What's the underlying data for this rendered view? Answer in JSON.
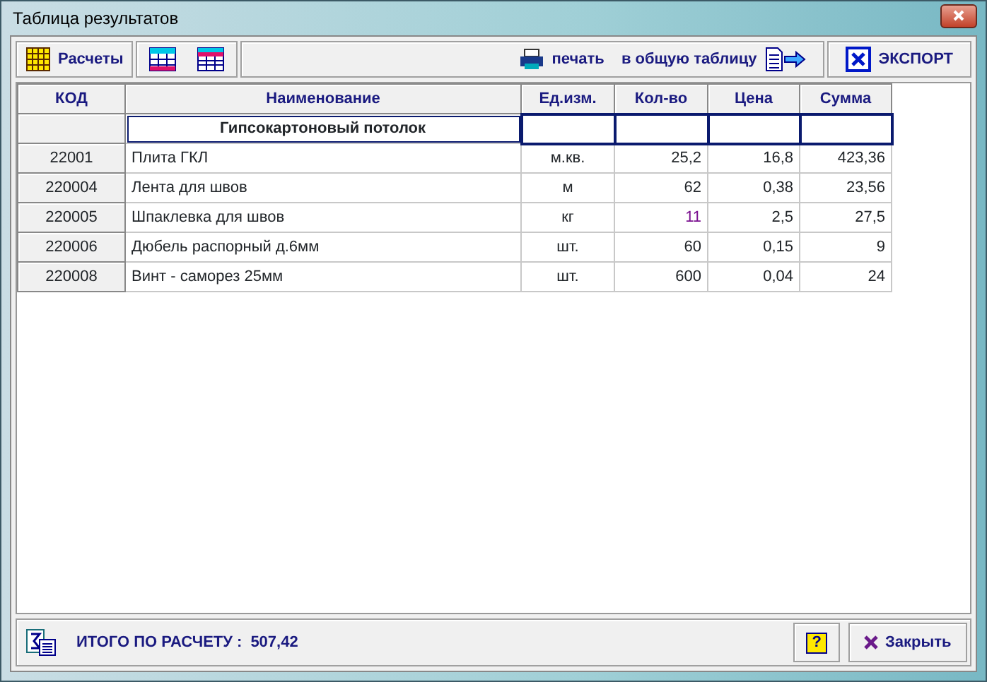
{
  "window": {
    "title": "Таблица результатов"
  },
  "toolbar": {
    "calc_button": "Расчеты",
    "print_button": "печать",
    "to_table_button": "в общую таблицу",
    "export_button": "ЭКСПОРТ"
  },
  "table": {
    "columns": [
      "КОД",
      "Наименование",
      "Ед.изм.",
      "Кол-во",
      "Цена",
      "Сумма"
    ],
    "group": {
      "title": "Гипсокартоновый потолок"
    },
    "rows": [
      {
        "code": "22001",
        "name": "Плита ГКЛ",
        "unit": "м.кв.",
        "qty": "25,2",
        "price": "16,8",
        "sum": "423,36",
        "qty_edited": false
      },
      {
        "code": "220004",
        "name": "Лента для швов",
        "unit": "м",
        "qty": "62",
        "price": "0,38",
        "sum": "23,56",
        "qty_edited": false
      },
      {
        "code": "220005",
        "name": "Шпаклевка для швов",
        "unit": "кг",
        "qty": "11",
        "price": "2,5",
        "sum": "27,5",
        "qty_edited": true
      },
      {
        "code": "220006",
        "name": "Дюбель распорный д.6мм",
        "unit": "шт.",
        "qty": "60",
        "price": "0,15",
        "sum": "9",
        "qty_edited": false
      },
      {
        "code": "220008",
        "name": "Винт - саморез 25мм",
        "unit": "шт.",
        "qty": "600",
        "price": "0,04",
        "sum": "24",
        "qty_edited": false
      }
    ]
  },
  "footer": {
    "total_label": "ИТОГО ПО РАСЧЕТУ :",
    "total_value": "507,42",
    "help_button": "?",
    "close_button": "Закрыть"
  }
}
